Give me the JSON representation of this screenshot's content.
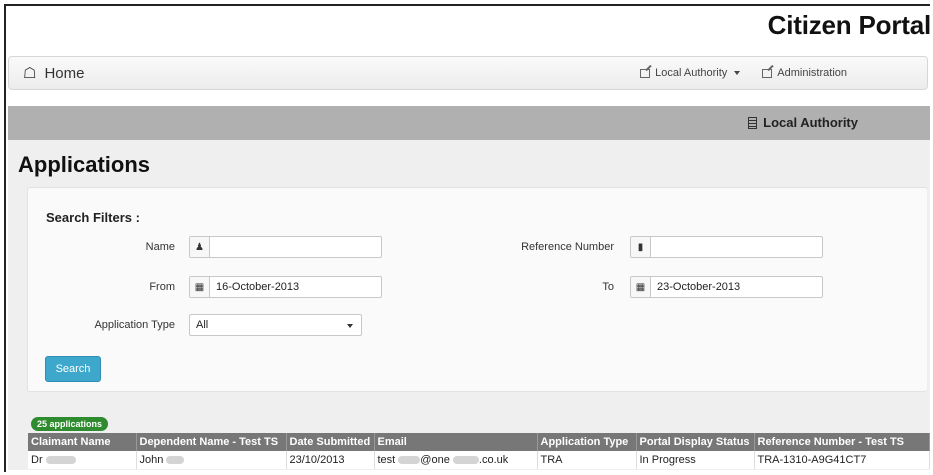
{
  "app": {
    "brand": "Citizen Portal"
  },
  "navbar": {
    "home_label": "Home",
    "local_authority_label": "Local Authority",
    "administration_label": "Administration"
  },
  "section_bar": {
    "title": "Local Authority"
  },
  "page": {
    "title": "Applications"
  },
  "filters": {
    "title": "Search Filters :",
    "name_label": "Name",
    "name_value": "",
    "reference_label": "Reference Number",
    "reference_value": "",
    "from_label": "From",
    "from_value": "16-October-2013",
    "to_label": "To",
    "to_value": "23-October-2013",
    "application_type_label": "Application Type",
    "application_type_value": "All",
    "search_button": "Search"
  },
  "results": {
    "count_badge": "25 applications",
    "columns": [
      "Claimant Name",
      "Dependent Name - Test TS",
      "Date Submitted",
      "Email",
      "Application Type",
      "Portal Display Status",
      "Reference Number - Test TS"
    ],
    "rows": [
      {
        "claimant_prefix": "Dr",
        "dependent_prefix": "John",
        "date_submitted": "23/10/2013",
        "email_start": "test",
        "email_mid": "@one",
        "email_end": ".co.uk",
        "application_type": "TRA",
        "status": "In Progress",
        "reference": "TRA-1310-A9G41CT7"
      }
    ]
  },
  "icons": {
    "home": "home-icon",
    "edit": "edit-icon",
    "building": "building-icon",
    "user": "user-icon",
    "book": "book-icon",
    "calendar": "calendar-icon"
  }
}
